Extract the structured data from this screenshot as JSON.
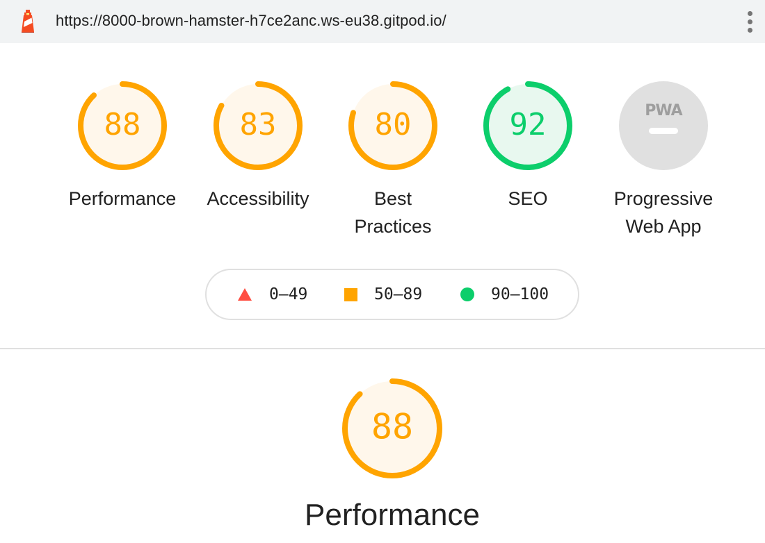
{
  "browser": {
    "url": "https://8000-brown-hamster-h7ce2anc.ws-eu38.gitpod.io/",
    "logo_icon": "lighthouse-icon",
    "menu_icon": "kebab-menu-icon"
  },
  "colors": {
    "average": "#ffa400",
    "average_bg": "#fff7eb",
    "pass": "#0cce6b",
    "pass_bg": "#e8f8ef",
    "fail": "#ff4e42",
    "na": "#e0e0e0",
    "na_fg": "#9e9e9e"
  },
  "gauges": [
    {
      "id": "performance",
      "score": "88",
      "label": "Performance",
      "rating": "average",
      "fraction": 0.88
    },
    {
      "id": "accessibility",
      "score": "83",
      "label": "Accessibility",
      "rating": "average",
      "fraction": 0.83
    },
    {
      "id": "best-practices",
      "score": "80",
      "label": "Best Practices",
      "rating": "average",
      "fraction": 0.8
    },
    {
      "id": "seo",
      "score": "92",
      "label": "SEO",
      "rating": "pass",
      "fraction": 0.92
    },
    {
      "id": "pwa",
      "badge": "PWA",
      "label": "Progressive Web App",
      "rating": "na",
      "badge_icon": "pwa-badge-icon"
    }
  ],
  "legend": {
    "fail": {
      "range": "0–49",
      "icon": "triangle-icon"
    },
    "average": {
      "range": "50–89",
      "icon": "square-icon"
    },
    "pass": {
      "range": "90–100",
      "icon": "circle-icon"
    }
  },
  "category": {
    "score": "88",
    "fraction": 0.88,
    "title": "Performance"
  }
}
